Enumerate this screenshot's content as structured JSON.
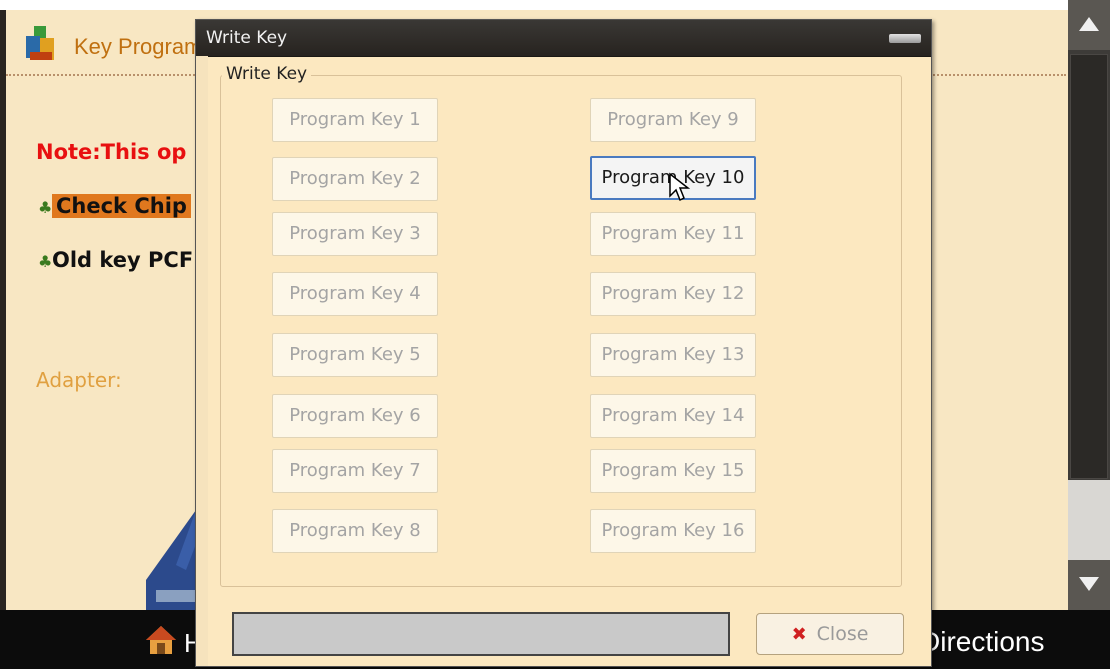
{
  "background_app": {
    "title": "Key Program",
    "note": "Note:This op",
    "bullets": [
      "Check Chip",
      "Old key PCF"
    ],
    "adapter_label": "Adapter:",
    "bottom_bar": {
      "home_label": "H",
      "directions_label": "Directions"
    }
  },
  "dialog": {
    "title": "Write Key",
    "group_label": "Write Key",
    "buttons": [
      {
        "label": "Program Key 1"
      },
      {
        "label": "Program Key 2"
      },
      {
        "label": "Program Key 3"
      },
      {
        "label": "Program Key 4"
      },
      {
        "label": "Program Key 5"
      },
      {
        "label": "Program Key 6"
      },
      {
        "label": "Program Key 7"
      },
      {
        "label": "Program Key 8"
      },
      {
        "label": "Program Key 9"
      },
      {
        "label": "Program Key 10"
      },
      {
        "label": "Program Key 11"
      },
      {
        "label": "Program Key 12"
      },
      {
        "label": "Program Key 13"
      },
      {
        "label": "Program Key 14"
      },
      {
        "label": "Program Key 15"
      },
      {
        "label": "Program Key 16"
      }
    ],
    "active_button": "Program Key 10",
    "close_label": "Close",
    "progress": 0
  },
  "colors": {
    "note_red": "#e81010",
    "accent_orange": "#e0781e",
    "dialog_bg": "#fce8c0",
    "active_border": "#4a7ac0"
  }
}
